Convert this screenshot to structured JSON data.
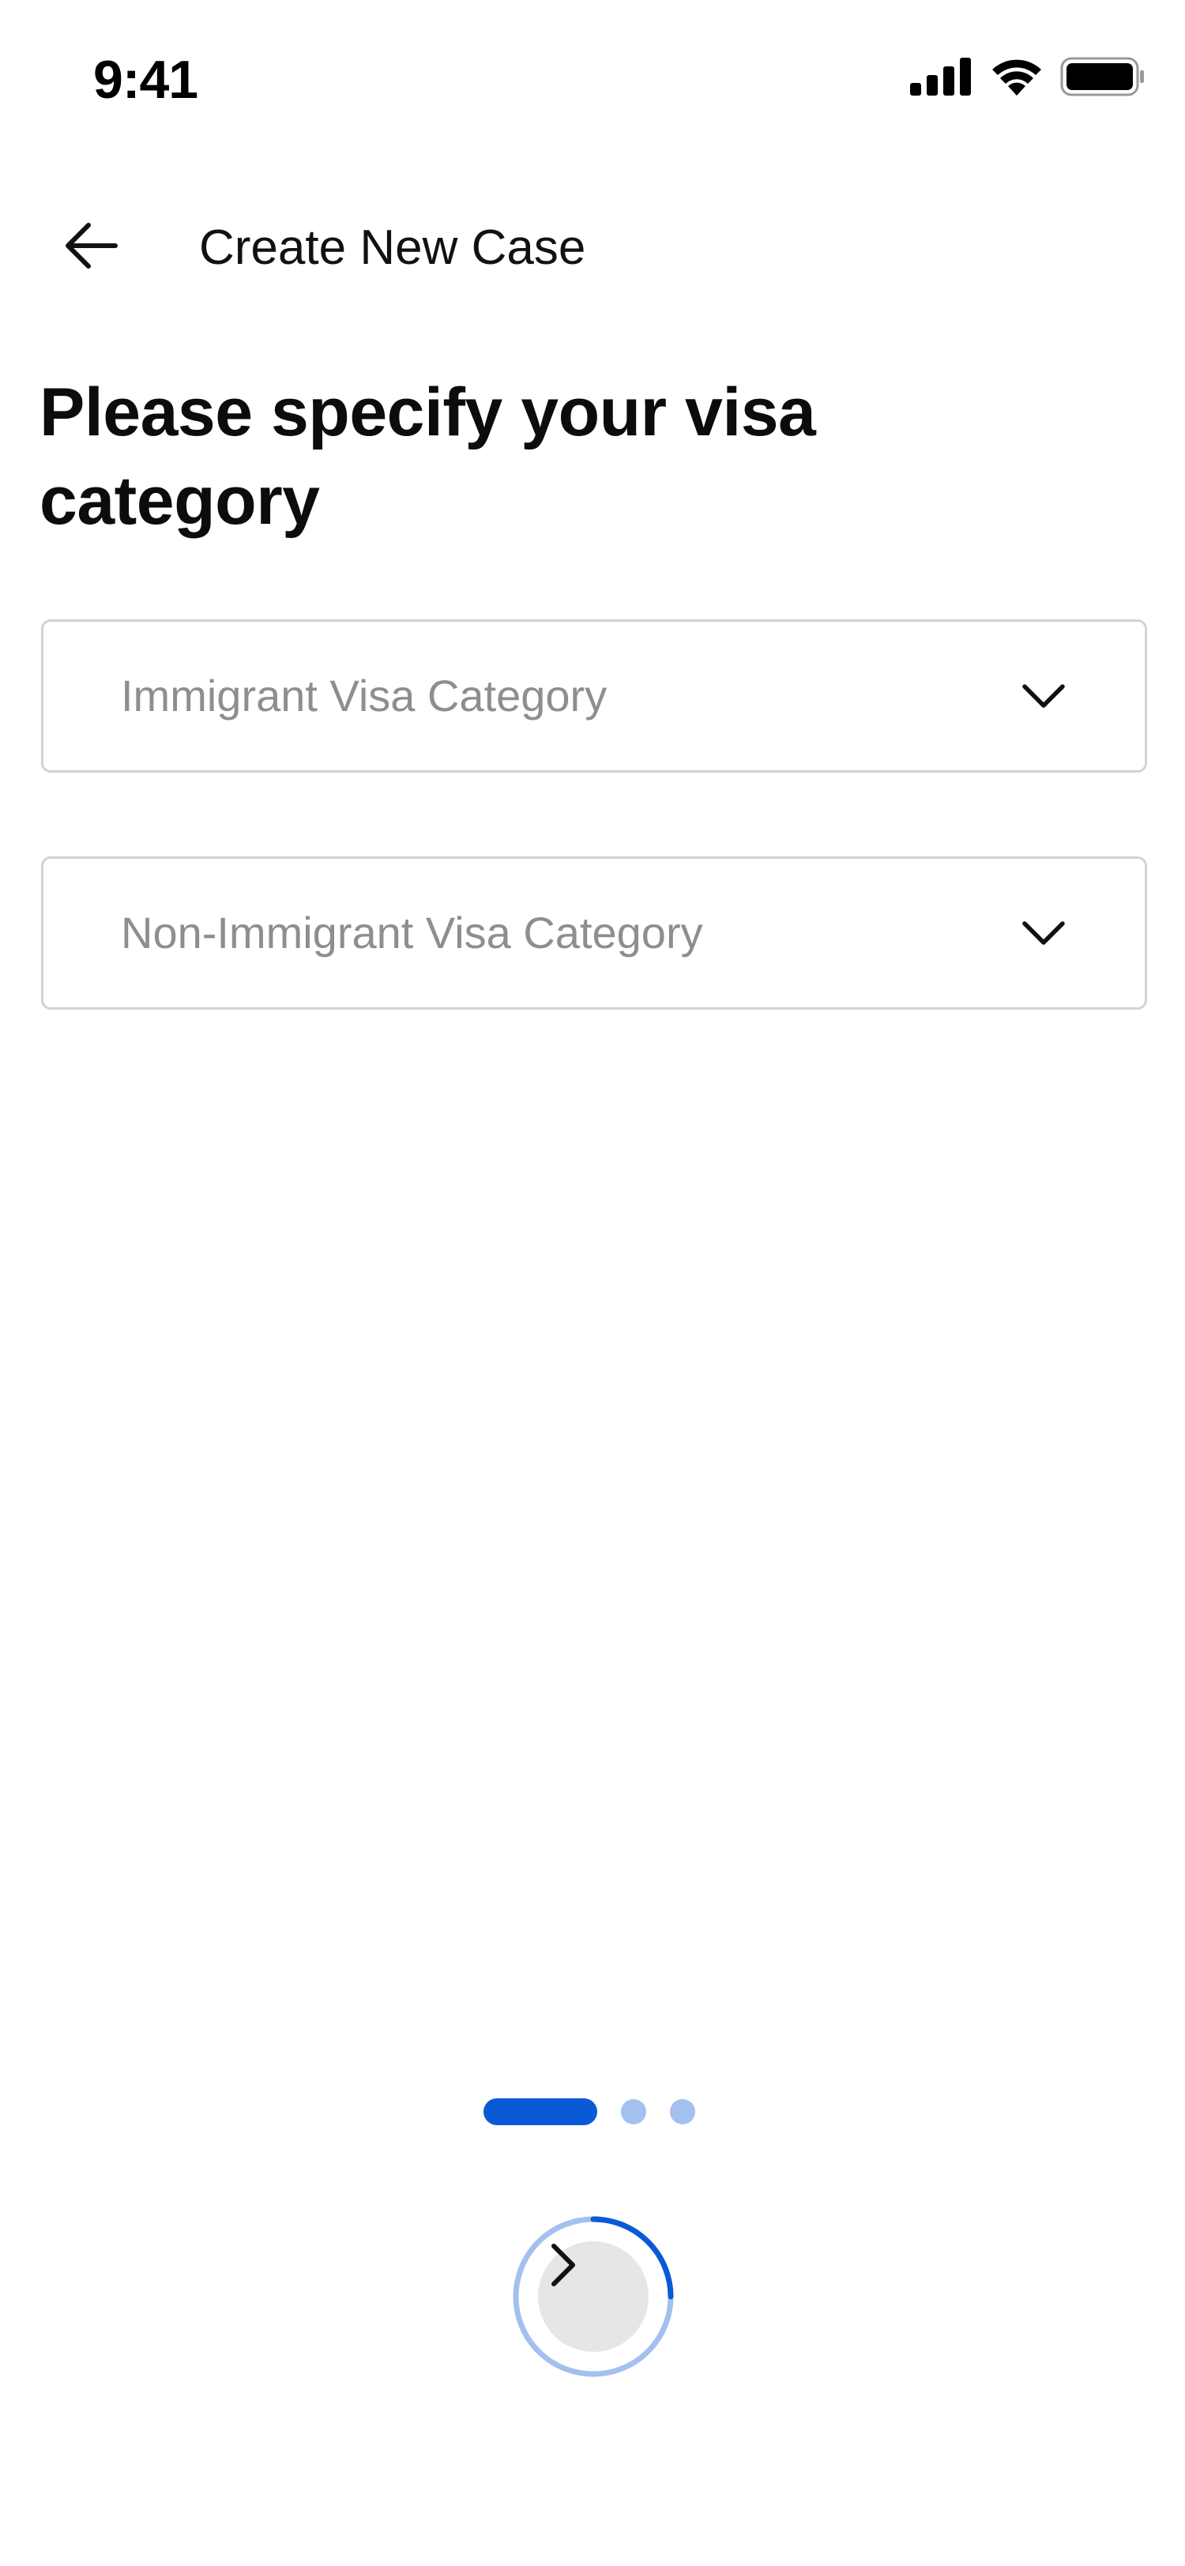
{
  "status_bar": {
    "time": "9:41",
    "icons": [
      "cellular-signal-icon",
      "wifi-icon",
      "battery-icon"
    ]
  },
  "header": {
    "back_icon": "arrow-left-icon",
    "title": "Create New Case"
  },
  "main": {
    "heading": "Please specify your visa category",
    "dropdowns": [
      {
        "placeholder": "Immigrant Visa Category",
        "value": "",
        "icon": "chevron-down-icon"
      },
      {
        "placeholder": "Non-Immigrant Visa Category",
        "value": "",
        "icon": "chevron-down-icon"
      }
    ]
  },
  "pagination": {
    "total_steps": 3,
    "current_step": 1
  },
  "next_button": {
    "icon": "chevron-right-icon",
    "progress": 0.25
  },
  "colors": {
    "accent": "#0a5ad6",
    "accent_light": "#a3c0ee",
    "placeholder": "#8e8e8e",
    "border": "#d3d3d3",
    "button_fill": "#e6e6e6"
  }
}
